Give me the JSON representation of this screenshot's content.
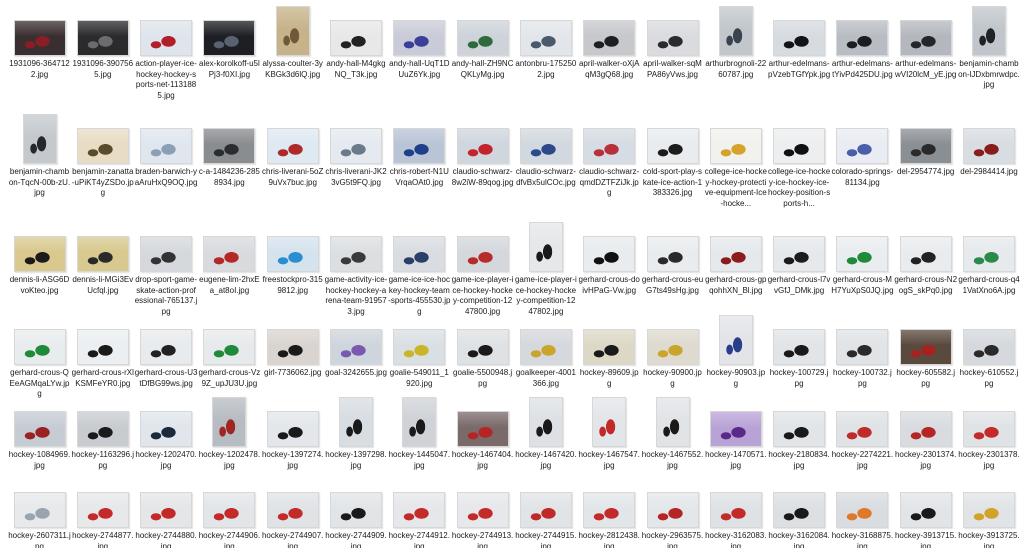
{
  "files": [
    {
      "name": "1931096-3647122.jpg",
      "thumb": {
        "orient": "landscape",
        "bg": "#3a2f30",
        "accent": "#8b1d24"
      }
    },
    {
      "name": "1931096-3907565.jpg",
      "thumb": {
        "orient": "landscape",
        "bg": "#2b2b2e",
        "accent": "#6b6b70"
      }
    },
    {
      "name": "action-player-ice-hockey-hockey-sports-net-1131885.jpg",
      "thumb": {
        "orient": "landscape",
        "bg": "#dfe5ec",
        "accent": "#b21f2a"
      }
    },
    {
      "name": "alex-korolkoff-u5lPj3-f0XI.jpg",
      "thumb": {
        "orient": "landscape",
        "bg": "#1d1f24",
        "accent": "#5a6270"
      }
    },
    {
      "name": "alyssa-coulter-3yKBGk3d6lQ.jpg",
      "thumb": {
        "orient": "portrait",
        "bg": "#c7b38a",
        "accent": "#6e5a3a"
      }
    },
    {
      "name": "andy-hall-M4gkgNQ_T3k.jpg",
      "thumb": {
        "orient": "landscape",
        "bg": "#e8e8e8",
        "accent": "#222222"
      }
    },
    {
      "name": "andy-hall-UqT1DUuZ6Yk.jpg",
      "thumb": {
        "orient": "landscape",
        "bg": "#c9ccd8",
        "accent": "#3b3f9a"
      }
    },
    {
      "name": "andy-hall-ZH9NCQKLyMg.jpg",
      "thumb": {
        "orient": "landscape",
        "bg": "#cdd3d9",
        "accent": "#2f6a3a"
      }
    },
    {
      "name": "antonbru-1752502.jpg",
      "thumb": {
        "orient": "landscape",
        "bg": "#e2e6ea",
        "accent": "#4a5a6a"
      }
    },
    {
      "name": "april-walker-oXjAqM3gQ68.jpg",
      "thumb": {
        "orient": "landscape",
        "bg": "#c6c8cc",
        "accent": "#1e1e24"
      }
    },
    {
      "name": "april-walker-sqMPA86yVws.jpg",
      "thumb": {
        "orient": "landscape",
        "bg": "#d9dbde",
        "accent": "#2a2a30"
      }
    },
    {
      "name": "arthurbrognoli-2260787.jpg",
      "thumb": {
        "orient": "portrait",
        "bg": "#c2c7cc",
        "accent": "#39444e"
      }
    },
    {
      "name": "arthur-edelmans-pVzebTGfYpk.jpg",
      "thumb": {
        "orient": "landscape",
        "bg": "#d6dbe0",
        "accent": "#11151a"
      }
    },
    {
      "name": "arthur-edelmans-tYivPd425DU.jpg",
      "thumb": {
        "orient": "landscape",
        "bg": "#b8bdc4",
        "accent": "#1a1d22"
      }
    },
    {
      "name": "arthur-edelmans-wVI20lcM_yE.jpg",
      "thumb": {
        "orient": "landscape",
        "bg": "#b4b8be",
        "accent": "#23262b"
      }
    },
    {
      "name": "benjamin-chambon-lJDxbmrwdpc.jpg",
      "thumb": {
        "orient": "portrait",
        "bg": "#c0c6cb",
        "accent": "#1f2226"
      }
    },
    {
      "name": "benjamin-chambon-TqcN-00b-zU.jpg",
      "thumb": {
        "orient": "portrait",
        "bg": "#c4c9cd",
        "accent": "#25282c"
      }
    },
    {
      "name": "benjamin-zanatta-uPiKT4yZSDo.jpg",
      "thumb": {
        "orient": "landscape",
        "bg": "#e9dcc4",
        "accent": "#5a4a2e"
      }
    },
    {
      "name": "braden-barwich-yaAruHxQ9OQ.jpg",
      "thumb": {
        "orient": "landscape",
        "bg": "#dfe6ee",
        "accent": "#8aa0b6"
      }
    },
    {
      "name": "c-a-1484236-2858934.jpg",
      "thumb": {
        "orient": "landscape",
        "bg": "#8a8d90",
        "accent": "#2a2c2f"
      }
    },
    {
      "name": "chris-liverani-5oZ9uVx7buc.jpg",
      "thumb": {
        "orient": "landscape",
        "bg": "#dfe9f2",
        "accent": "#b02a2a"
      }
    },
    {
      "name": "chris-liverani-JK23vG5t9FQ.jpg",
      "thumb": {
        "orient": "landscape",
        "bg": "#e4eaf0",
        "accent": "#6a7a8a"
      }
    },
    {
      "name": "chris-robert-N1UVrqaOAt0.jpg",
      "thumb": {
        "orient": "landscape",
        "bg": "#b9c4d6",
        "accent": "#1f3f8a"
      }
    },
    {
      "name": "claudio-schwarz-8w2iW-89qog.jpg",
      "thumb": {
        "orient": "landscape",
        "bg": "#cfd6de",
        "accent": "#c2252d"
      }
    },
    {
      "name": "claudio-schwarz-dfvBx5ulCOc.jpg",
      "thumb": {
        "orient": "landscape",
        "bg": "#d2d8df",
        "accent": "#2c4a8a"
      }
    },
    {
      "name": "claudio-schwarz-qmdDZTFZiJk.jpg",
      "thumb": {
        "orient": "landscape",
        "bg": "#d6dce3",
        "accent": "#b83039"
      }
    },
    {
      "name": "cold-sport-play-skate-ice-action-1383326.jpg",
      "thumb": {
        "orient": "landscape",
        "bg": "#e8ecef",
        "accent": "#1c1c1c"
      }
    },
    {
      "name": "college-ice-hockey-hockey-protective-equipment-Ice-hocke...",
      "thumb": {
        "orient": "landscape",
        "bg": "#f1f1ee",
        "accent": "#d5a32b"
      }
    },
    {
      "name": "college-ice-hockey-ice-hockey-ice-hockey-position-sports-h...",
      "thumb": {
        "orient": "landscape",
        "bg": "#eceeef",
        "accent": "#111111"
      }
    },
    {
      "name": "colorado-springs-81134.jpg",
      "thumb": {
        "orient": "landscape",
        "bg": "#e9ecf2",
        "accent": "#4a5fa8"
      }
    },
    {
      "name": "del-2954774.jpg",
      "thumb": {
        "orient": "landscape",
        "bg": "#8a8f94",
        "accent": "#2a2a2a"
      }
    },
    {
      "name": "del-2984414.jpg",
      "thumb": {
        "orient": "landscape",
        "bg": "#d8dde2",
        "accent": "#8a1c1c"
      }
    },
    {
      "name": "dennis-li-ASG6DvoKteo.jpg",
      "thumb": {
        "orient": "landscape",
        "bg": "#d9c98f",
        "accent": "#1b1b1b"
      }
    },
    {
      "name": "dennis-li-MGi3EvUcfql.jpg",
      "thumb": {
        "orient": "landscape",
        "bg": "#d8c98e",
        "accent": "#2a2a2a"
      }
    },
    {
      "name": "drop-sport-game-skate-action-professional-765137.jpg",
      "thumb": {
        "orient": "landscape",
        "bg": "#d5d9dd",
        "accent": "#333333"
      }
    },
    {
      "name": "eugene-lim-2hxEa_at8oI.jpg",
      "thumb": {
        "orient": "landscape",
        "bg": "#d8dade",
        "accent": "#b42828"
      }
    },
    {
      "name": "freestockpro-3159812.jpg",
      "thumb": {
        "orient": "landscape",
        "bg": "#d5e3ee",
        "accent": "#2a8fd0"
      }
    },
    {
      "name": "game-activity-ice-hockey-hockey-arena-team-919573.jpg",
      "thumb": {
        "orient": "landscape",
        "bg": "#dcdfe2",
        "accent": "#3a3a3a"
      }
    },
    {
      "name": "game-ice-ice-hockey-hockey-team-sports-455530.jpg",
      "thumb": {
        "orient": "landscape",
        "bg": "#d9dde1",
        "accent": "#2a3f6a"
      }
    },
    {
      "name": "game-ice-player-ice-hockey-hockey-competition-1247800.jpg",
      "thumb": {
        "orient": "landscape",
        "bg": "#d4d8dc",
        "accent": "#b72b2b"
      }
    },
    {
      "name": "game-ice-player-ice-hockey-hockey-competition-1247802.jpg",
      "thumb": {
        "orient": "portrait",
        "bg": "#e5e7e9",
        "accent": "#1a1a1a"
      }
    },
    {
      "name": "gerhard-crous-doivHPaG-Vw.jpg",
      "thumb": {
        "orient": "landscape",
        "bg": "#e8ecee",
        "accent": "#111111"
      }
    },
    {
      "name": "gerhard-crous-euG7ts49sHg.jpg",
      "thumb": {
        "orient": "landscape",
        "bg": "#e9ecee",
        "accent": "#2a2a2a"
      }
    },
    {
      "name": "gerhard-crous-gpqohhXN_Bl.jpg",
      "thumb": {
        "orient": "landscape",
        "bg": "#e6e9ec",
        "accent": "#8a1c1c"
      }
    },
    {
      "name": "gerhard-crous-l7vvGfJ_DMk.jpg",
      "thumb": {
        "orient": "landscape",
        "bg": "#e6e9ec",
        "accent": "#1c1c1c"
      }
    },
    {
      "name": "gerhard-crous-MH7YuXpS0JQ.jpg",
      "thumb": {
        "orient": "landscape",
        "bg": "#eaedef",
        "accent": "#1f8a3a"
      }
    },
    {
      "name": "gerhard-crous-N2ogS_skPq0.jpg",
      "thumb": {
        "orient": "landscape",
        "bg": "#e9ecee",
        "accent": "#222222"
      }
    },
    {
      "name": "gerhard-crous-q41VatXno6A.jpg",
      "thumb": {
        "orient": "landscape",
        "bg": "#e6eaec",
        "accent": "#2a8a4a"
      }
    },
    {
      "name": "gerhard-crous-QEeAGMqaLYw.jpg",
      "thumb": {
        "orient": "landscape",
        "bg": "#e9ecee",
        "accent": "#1f8a3a"
      }
    },
    {
      "name": "gerhard-crous-rXlKSMFeYR0.jpg",
      "thumb": {
        "orient": "landscape",
        "bg": "#eceff1",
        "accent": "#1a1a1a"
      }
    },
    {
      "name": "gerhard-crous-U3tDfBG99ws.jpg",
      "thumb": {
        "orient": "landscape",
        "bg": "#e8ebed",
        "accent": "#222222"
      }
    },
    {
      "name": "gerhard-crous-Vz9Z_upJU3U.jpg",
      "thumb": {
        "orient": "landscape",
        "bg": "#e7eaec",
        "accent": "#1f8a3a"
      }
    },
    {
      "name": "girl-7736062.jpg",
      "thumb": {
        "orient": "landscape",
        "bg": "#d9d4cf",
        "accent": "#1a1a1a"
      }
    },
    {
      "name": "goal-3242655.jpg",
      "thumb": {
        "orient": "landscape",
        "bg": "#cfd5dc",
        "accent": "#7a5ab0"
      }
    },
    {
      "name": "goalie-549011_1920.jpg",
      "thumb": {
        "orient": "landscape",
        "bg": "#dadfe3",
        "accent": "#c8b52a"
      }
    },
    {
      "name": "goalie-5500948.jpg",
      "thumb": {
        "orient": "landscape",
        "bg": "#dfe2e4",
        "accent": "#1a1a1a"
      }
    },
    {
      "name": "goalkeeper-4001366.jpg",
      "thumb": {
        "orient": "landscape",
        "bg": "#d5d8dc",
        "accent": "#c9a52a"
      }
    },
    {
      "name": "hockey-89609.jpg",
      "thumb": {
        "orient": "landscape",
        "bg": "#ddd8c6",
        "accent": "#1a1a1a"
      }
    },
    {
      "name": "hockey-90900.jpg",
      "thumb": {
        "orient": "landscape",
        "bg": "#dedad0",
        "accent": "#c9a52a"
      }
    },
    {
      "name": "hockey-90903.jpg",
      "thumb": {
        "orient": "portrait",
        "bg": "#e2e4e8",
        "accent": "#2a3f8a"
      }
    },
    {
      "name": "hockey-100729.jpg",
      "thumb": {
        "orient": "landscape",
        "bg": "#e2e5e8",
        "accent": "#1a1a1a"
      }
    },
    {
      "name": "hockey-100732.jpg",
      "thumb": {
        "orient": "landscape",
        "bg": "#e0e4e7",
        "accent": "#2a2a2a"
      }
    },
    {
      "name": "hockey-605582.jpg",
      "thumb": {
        "orient": "landscape",
        "bg": "#5a4a3e",
        "accent": "#a7221f"
      }
    },
    {
      "name": "hockey-610552.jpg",
      "thumb": {
        "orient": "landscape",
        "bg": "#d5d9dd",
        "accent": "#2a2a2a"
      }
    },
    {
      "name": "hockey-1084969.jpg",
      "thumb": {
        "orient": "landscape",
        "bg": "#c6ccd3",
        "accent": "#9a2222"
      }
    },
    {
      "name": "hockey-1163296.jpg",
      "thumb": {
        "orient": "landscape",
        "bg": "#c8ccd0",
        "accent": "#1a1a1a"
      }
    },
    {
      "name": "hockey-1202470.jpg",
      "thumb": {
        "orient": "landscape",
        "bg": "#e0e6ec",
        "accent": "#1a2a3a"
      }
    },
    {
      "name": "hockey-1202478.jpg",
      "thumb": {
        "orient": "portrait",
        "bg": "#b7bcc3",
        "accent": "#a02525"
      }
    },
    {
      "name": "hockey-1397274.jpg",
      "thumb": {
        "orient": "landscape",
        "bg": "#e3e7eb",
        "accent": "#1a1a1a"
      }
    },
    {
      "name": "hockey-1397298.jpg",
      "thumb": {
        "orient": "portrait",
        "bg": "#d8dde2",
        "accent": "#1a1a1a"
      }
    },
    {
      "name": "hockey-1445047.jpg",
      "thumb": {
        "orient": "portrait",
        "bg": "#cfd3d7",
        "accent": "#1a1a1a"
      }
    },
    {
      "name": "hockey-1467404.jpg",
      "thumb": {
        "orient": "landscape",
        "bg": "#7a6a6a",
        "accent": "#b52525"
      }
    },
    {
      "name": "hockey-1467420.jpg",
      "thumb": {
        "orient": "portrait",
        "bg": "#dde1e5",
        "accent": "#1a1a1a"
      }
    },
    {
      "name": "hockey-1467547.jpg",
      "thumb": {
        "orient": "portrait",
        "bg": "#e3e6e9",
        "accent": "#c22a2a"
      }
    },
    {
      "name": "hockey-1467552.jpg",
      "thumb": {
        "orient": "portrait",
        "bg": "#e1e4e7",
        "accent": "#1a1a1a"
      }
    },
    {
      "name": "hockey-1470571.jpg",
      "thumb": {
        "orient": "landscape",
        "bg": "#b9a3d6",
        "accent": "#5a2a8a"
      }
    },
    {
      "name": "hockey-2180834.jpg",
      "thumb": {
        "orient": "landscape",
        "bg": "#e1e5e8",
        "accent": "#1a1a1a"
      }
    },
    {
      "name": "hockey-2274221.jpg",
      "thumb": {
        "orient": "landscape",
        "bg": "#dfe3e6",
        "accent": "#c02a2a"
      }
    },
    {
      "name": "hockey-2301374.jpg",
      "thumb": {
        "orient": "landscape",
        "bg": "#d8dce0",
        "accent": "#b52525"
      }
    },
    {
      "name": "hockey-2301378.jpg",
      "thumb": {
        "orient": "landscape",
        "bg": "#e0e3e6",
        "accent": "#c42a2a"
      }
    },
    {
      "name": "hockey-2607311.jpg",
      "thumb": {
        "orient": "landscape",
        "bg": "#e7e9ea",
        "accent": "#9aa4b0"
      }
    },
    {
      "name": "hockey-2744877.jpg",
      "thumb": {
        "orient": "landscape",
        "bg": "#e6e8ea",
        "accent": "#c52a2a"
      }
    },
    {
      "name": "hockey-2744880.jpg",
      "thumb": {
        "orient": "landscape",
        "bg": "#e4e6e8",
        "accent": "#c32929"
      }
    },
    {
      "name": "hockey-2744906.jpg",
      "thumb": {
        "orient": "landscape",
        "bg": "#e3e6e9",
        "accent": "#c42a2a"
      }
    },
    {
      "name": "hockey-2744907.jpg",
      "thumb": {
        "orient": "landscape",
        "bg": "#e0e3e6",
        "accent": "#c32a2a"
      }
    },
    {
      "name": "hockey-2744909.jpg",
      "thumb": {
        "orient": "landscape",
        "bg": "#e2e5e8",
        "accent": "#1a1a1a"
      }
    },
    {
      "name": "hockey-2744912.jpg",
      "thumb": {
        "orient": "landscape",
        "bg": "#e5e7ea",
        "accent": "#c42a2a"
      }
    },
    {
      "name": "hockey-2744913.jpg",
      "thumb": {
        "orient": "landscape",
        "bg": "#e6e8eb",
        "accent": "#c42a2a"
      }
    },
    {
      "name": "hockey-2744915.jpg",
      "thumb": {
        "orient": "landscape",
        "bg": "#e1e4e7",
        "accent": "#c12828"
      }
    },
    {
      "name": "hockey-2812438.jpg",
      "thumb": {
        "orient": "landscape",
        "bg": "#e3e6e9",
        "accent": "#c32a2a"
      }
    },
    {
      "name": "hockey-2963575.jpg",
      "thumb": {
        "orient": "landscape",
        "bg": "#e4e7ea",
        "accent": "#b52525"
      }
    },
    {
      "name": "hockey-3162083.jpg",
      "thumb": {
        "orient": "landscape",
        "bg": "#dfe2e5",
        "accent": "#c32a2a"
      }
    },
    {
      "name": "hockey-3162084.jpg",
      "thumb": {
        "orient": "landscape",
        "bg": "#dde0e3",
        "accent": "#1a1a1a"
      }
    },
    {
      "name": "hockey-3168875.jpg",
      "thumb": {
        "orient": "landscape",
        "bg": "#d9dce0",
        "accent": "#e0782a"
      }
    },
    {
      "name": "hockey-3913715.jpg",
      "thumb": {
        "orient": "landscape",
        "bg": "#e2e5e8",
        "accent": "#1a1a1a"
      }
    },
    {
      "name": "hockey-3913725.jpg",
      "thumb": {
        "orient": "landscape",
        "bg": "#e1e4e7",
        "accent": "#d2a32a"
      }
    }
  ]
}
